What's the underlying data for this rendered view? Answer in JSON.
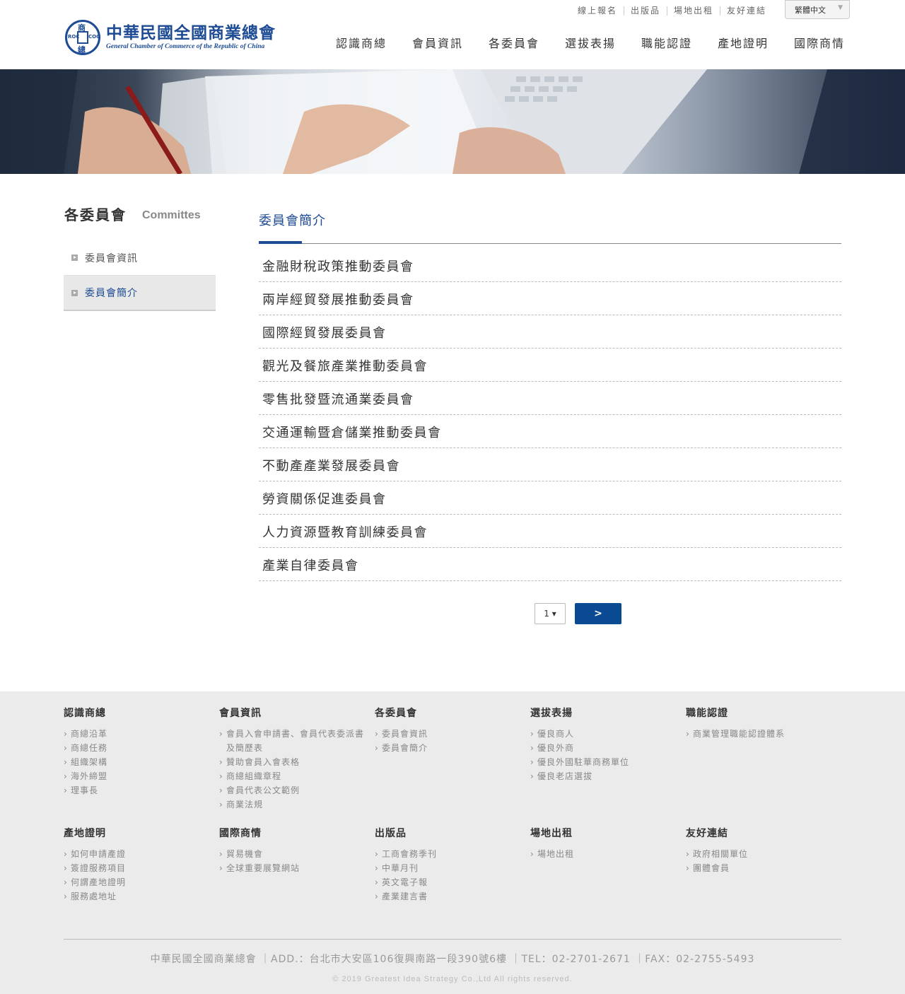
{
  "brand": {
    "name_zh": "中華民國全國商業總會",
    "name_en": "General Chamber of Commerce of the Republic of China",
    "seal_top": "商",
    "seal_bottom": "總",
    "seal_left": "ROC",
    "seal_right": "COC",
    "color": "#1d4b94"
  },
  "topbar": {
    "links": [
      "線上報名",
      "出版品",
      "場地出租",
      "友好連結"
    ],
    "language": "繁體中文"
  },
  "mainnav": [
    "認識商總",
    "會員資訊",
    "各委員會",
    "選拔表揚",
    "職能認證",
    "產地證明",
    "國際商情"
  ],
  "sidebar": {
    "title": "各委員會",
    "subtitle": "Committes",
    "items": [
      {
        "label": "委員會資訊",
        "active": false
      },
      {
        "label": "委員會簡介",
        "active": true
      }
    ]
  },
  "content": {
    "title": "委員會簡介",
    "items": [
      "金融財稅政策推動委員會",
      "兩岸經貿發展推動委員會",
      "國際經貿發展委員會",
      "觀光及餐旅產業推動委員會",
      "零售批發暨流通業委員會",
      "交通運輸暨倉儲業推動委員會",
      "不動產產業發展委員會",
      "勞資關係促進委員會",
      "人力資源暨教育訓練委員會",
      "產業自律委員會"
    ],
    "pager": {
      "current": "1",
      "next_label": ">"
    }
  },
  "footer": {
    "columns": [
      {
        "title": "認識商總",
        "items": [
          "商總沿革",
          "商總任務",
          "組織架構",
          "海外締盟",
          "理事長"
        ]
      },
      {
        "title": "會員資訊",
        "items": [
          "會員入會申請書、會員代表委派書及簡歷表",
          "贊助會員入會表格",
          "商總組織章程",
          "會員代表公文範例",
          "商業法規"
        ]
      },
      {
        "title": "各委員會",
        "items": [
          "委員會資訊",
          "委員會簡介"
        ]
      },
      {
        "title": "選拔表揚",
        "items": [
          "優良商人",
          "優良外商",
          "優良外國駐華商務單位",
          "優良老店選拔"
        ]
      },
      {
        "title": "職能認證",
        "items": [
          "商業管理職能認證體系"
        ]
      },
      {
        "title": "產地證明",
        "items": [
          "如何申請產證",
          "簽證服務項目",
          "何謂產地證明",
          "服務處地址"
        ]
      },
      {
        "title": "國際商情",
        "items": [
          "貿易機會",
          "全球重要展覽網站"
        ]
      },
      {
        "title": "出版品",
        "items": [
          "工商會務季刊",
          "中華月刊",
          "英文電子報",
          "產業建言書"
        ]
      },
      {
        "title": "場地出租",
        "items": [
          "場地出租"
        ]
      },
      {
        "title": "友好連結",
        "items": [
          "政府相關單位",
          "團體會員"
        ]
      }
    ],
    "address": "中華民國全國商業總會 ｜ADD.：台北市大安區106復興南路一段390號6樓 ｜TEL：02-2701-2671 ｜FAX：02-2755-5493",
    "copyright": "© 2019 Greatest Idea Strategy Co.,Ltd All rights reserved."
  }
}
